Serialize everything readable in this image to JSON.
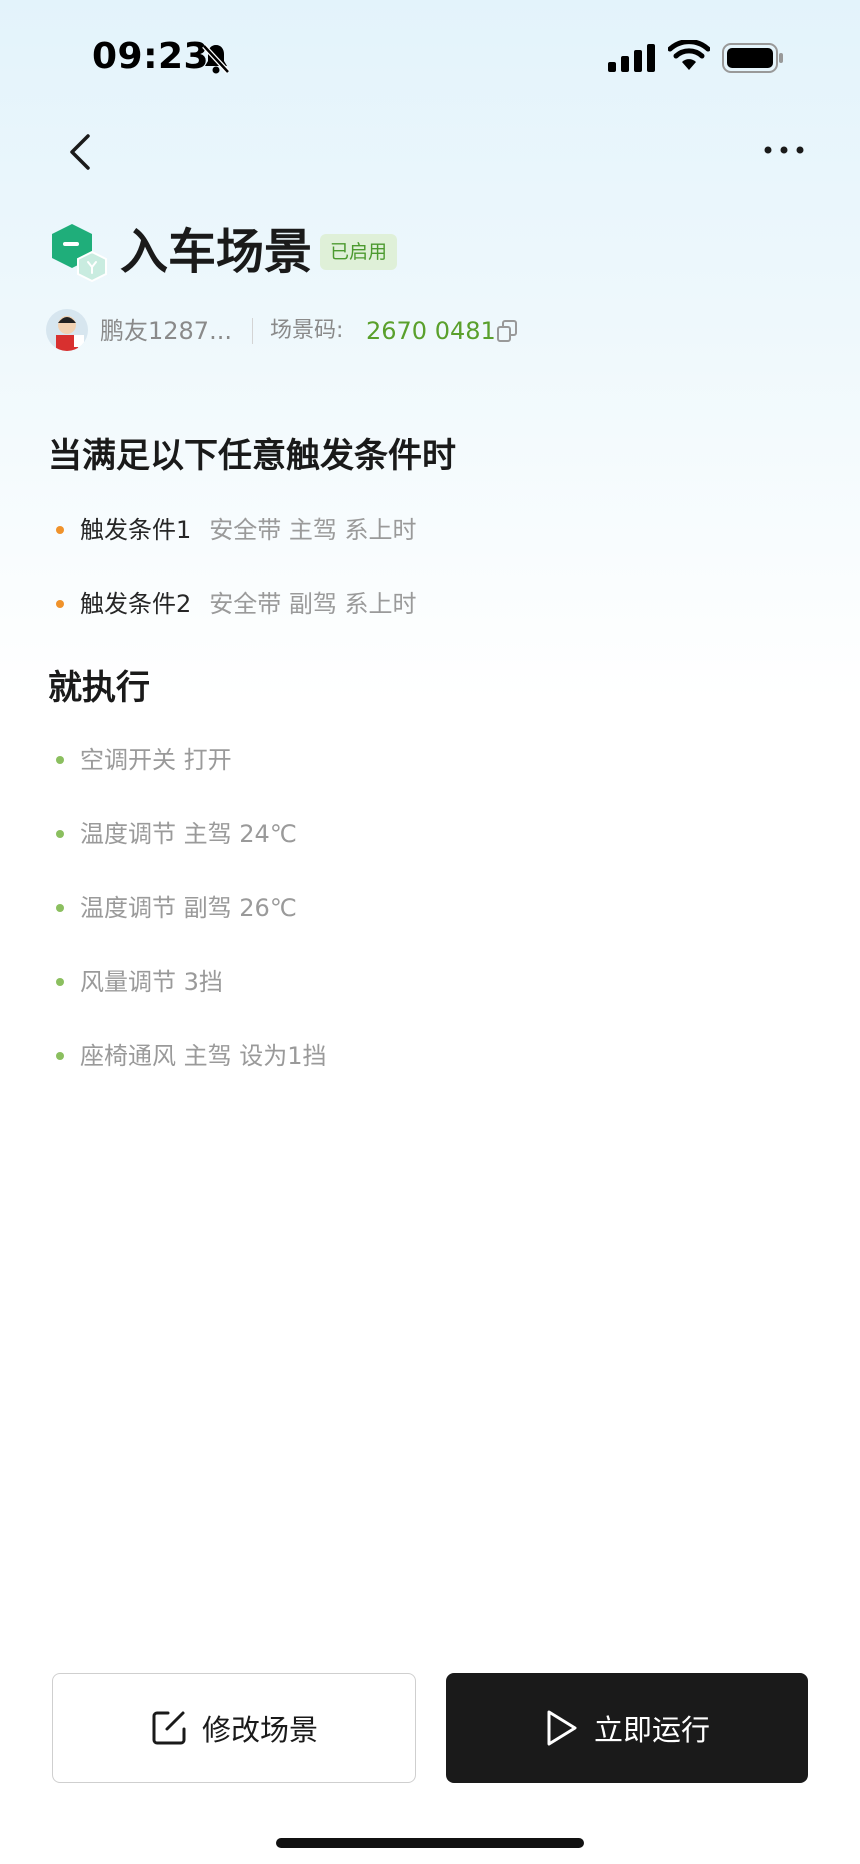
{
  "status_bar": {
    "time": "09:23"
  },
  "header": {
    "title": "入车场景",
    "badge": "已启用",
    "author": "鹏友1287...",
    "code_label": "场景码:",
    "code_value": "2670 0481"
  },
  "triggers": {
    "title": "当满足以下任意触发条件时",
    "items": [
      {
        "label": "触发条件1",
        "value": "安全带 主驾 系上时"
      },
      {
        "label": "触发条件2",
        "value": "安全带 副驾 系上时"
      }
    ]
  },
  "actions": {
    "title": "就执行",
    "items": [
      "空调开关 打开",
      "温度调节 主驾 24℃",
      "温度调节 副驾 26℃",
      "风量调节 3挡",
      "座椅通风 主驾 设为1挡"
    ]
  },
  "buttons": {
    "edit": "修改场景",
    "run": "立即运行"
  },
  "colors": {
    "accent_green": "#5aa02c",
    "badge_bg": "#dff0d8",
    "trigger_dot": "#f0922b",
    "action_dot": "#8bbf5f",
    "primary_button": "#1a1a1a"
  },
  "icons": [
    "bell-slash-icon",
    "signal-icon",
    "wifi-icon",
    "battery-icon",
    "back-icon",
    "more-icon",
    "scene-cube-icon",
    "copy-icon",
    "edit-icon",
    "play-icon"
  ]
}
